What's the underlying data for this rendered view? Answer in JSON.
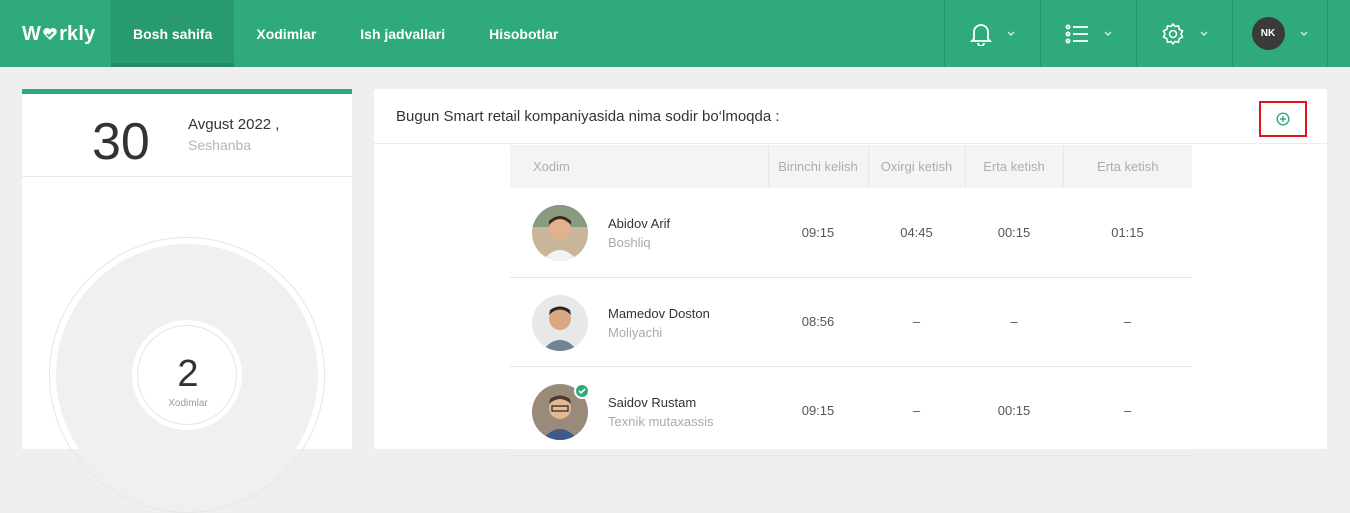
{
  "app": {
    "logo": "Workly"
  },
  "nav": [
    {
      "label": "Bosh sahifa",
      "active": true
    },
    {
      "label": "Xodimlar",
      "active": false
    },
    {
      "label": "Ish jadvallari",
      "active": false
    },
    {
      "label": "Hisobotlar",
      "active": false
    }
  ],
  "user": {
    "initials": "NK"
  },
  "date": {
    "day": "30",
    "month_year": "Avgust 2022 ,",
    "weekday": "Seshanba"
  },
  "summary": {
    "count": "2",
    "label": "Xodimlar"
  },
  "feed": {
    "headline": "Bugun Smart retail kompaniyasida nima sodir bo‘lmoqda :",
    "columns": [
      "Xodim",
      "Birinchi kelish",
      "Oxirgi ketish",
      "Erta ketish",
      "Erta ketish"
    ],
    "rows": [
      {
        "name": "Abidov Arif",
        "role": "Boshliq",
        "first_in": "09:15",
        "last_out": "04:45",
        "early1": "00:15",
        "early2": "01:15"
      },
      {
        "name": "Mamedov Doston",
        "role": "Moliyachi",
        "first_in": "08:56",
        "last_out": "–",
        "early1": "–",
        "early2": "–"
      },
      {
        "name": "Saidov Rustam",
        "role": "Texnik mutaxassis",
        "first_in": "09:15",
        "last_out": "–",
        "early1": "00:15",
        "early2": "–"
      }
    ]
  },
  "colors": {
    "brand": "#2eaa7b",
    "late": "#f4c21b",
    "highlight_border": "#e0141a"
  }
}
